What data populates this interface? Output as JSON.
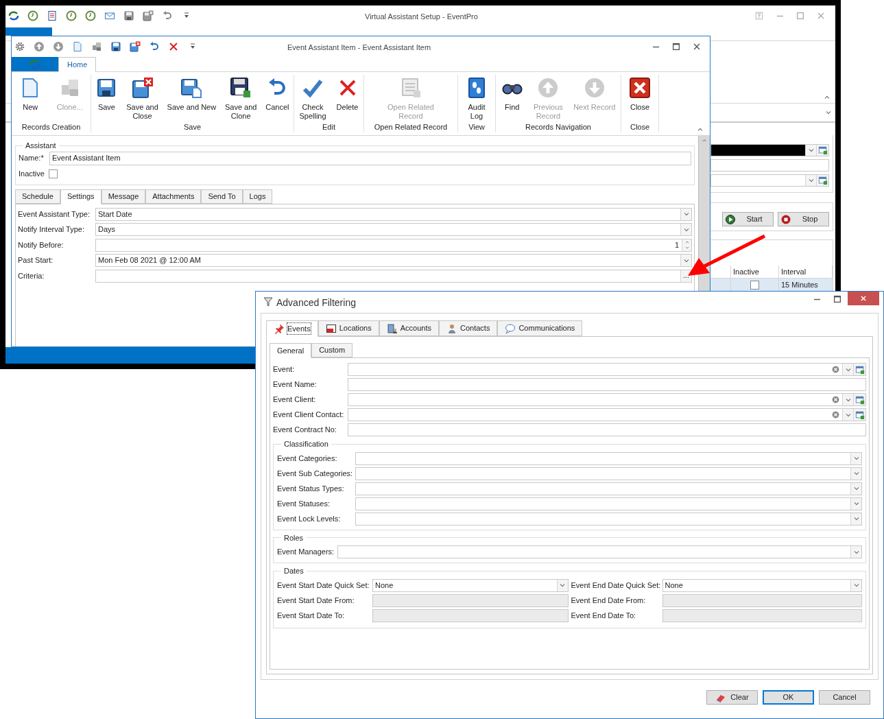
{
  "main_window": {
    "title": "Virtual Assistant Setup - EventPro",
    "control_buttons": [
      "Start",
      "Stop"
    ],
    "grid": {
      "columns": [
        "Inactive",
        "Interval"
      ],
      "rows": [
        {
          "inactive": false,
          "interval": "15 Minutes",
          "selected": true
        }
      ]
    }
  },
  "item_window": {
    "title": "Event Assistant Item - Event Assistant Item",
    "ribbon_tabs": [
      {
        "label": "Home",
        "selected": true
      }
    ],
    "ribbon_groups": [
      {
        "label": "Records Creation",
        "buttons": [
          {
            "label": "New",
            "disabled": false
          },
          {
            "label": "Clone...",
            "disabled": true
          }
        ]
      },
      {
        "label": "Save",
        "buttons": [
          {
            "label": "Save",
            "disabled": false
          },
          {
            "label": "Save and\nClose",
            "disabled": false
          },
          {
            "label": "Save and New",
            "disabled": false
          },
          {
            "label": "Save and\nClone",
            "disabled": false
          },
          {
            "label": "Cancel",
            "disabled": false
          }
        ]
      },
      {
        "label": "Edit",
        "buttons": [
          {
            "label": "Check\nSpelling",
            "disabled": false
          },
          {
            "label": "Delete",
            "disabled": false
          }
        ]
      },
      {
        "label": "Open Related Record",
        "buttons": [
          {
            "label": "Open Related\nRecord",
            "disabled": true
          }
        ]
      },
      {
        "label": "View",
        "buttons": [
          {
            "label": "Audit\nLog",
            "disabled": false
          }
        ]
      },
      {
        "label": "Records Navigation",
        "buttons": [
          {
            "label": "Find",
            "disabled": false
          },
          {
            "label": "Previous\nRecord",
            "disabled": true
          },
          {
            "label": "Next Record",
            "disabled": true
          }
        ]
      },
      {
        "label": "Close",
        "buttons": [
          {
            "label": "Close",
            "disabled": false
          }
        ]
      }
    ],
    "assistant": {
      "legend": "Assistant",
      "name_label": "Name:*",
      "name_value": "Event Assistant Item",
      "inactive_label": "Inactive",
      "inactive_checked": false
    },
    "tabs": [
      {
        "label": "Schedule",
        "selected": false
      },
      {
        "label": "Settings",
        "selected": true
      },
      {
        "label": "Message",
        "selected": false
      },
      {
        "label": "Attachments",
        "selected": false
      },
      {
        "label": "Send To",
        "selected": false
      },
      {
        "label": "Logs",
        "selected": false
      }
    ],
    "fields": [
      {
        "label": "Event Assistant Type:",
        "kind": "dropdown",
        "value": "Start Date"
      },
      {
        "label": "Notify Interval Type:",
        "kind": "dropdown",
        "value": "Days"
      },
      {
        "label": "Notify Before:",
        "kind": "spin",
        "value": "1"
      },
      {
        "label": "Past Start:",
        "kind": "dropdown",
        "value": "Mon Feb 08 2021 @ 12:00 AM"
      },
      {
        "label": "Criteria:",
        "kind": "ellipsis",
        "button": "..."
      }
    ]
  },
  "filter_dialog": {
    "title": "Advanced Filtering",
    "tabs": [
      {
        "label": "Events",
        "selected": true
      },
      {
        "label": "Locations",
        "selected": false
      },
      {
        "label": "Accounts",
        "selected": false
      },
      {
        "label": "Contacts",
        "selected": false
      },
      {
        "label": "Communications",
        "selected": false
      }
    ],
    "subtabs": [
      {
        "label": "General",
        "selected": true
      },
      {
        "label": "Custom",
        "selected": false
      }
    ],
    "fields": [
      {
        "label": "Event:",
        "kind": "lookup"
      },
      {
        "label": "Event Name:",
        "kind": "text"
      },
      {
        "label": "Event Client:",
        "kind": "lookup"
      },
      {
        "label": "Event Client Contact:",
        "kind": "lookup"
      },
      {
        "label": "Event Contract No:",
        "kind": "text"
      }
    ],
    "groups": [
      {
        "legend": "Classification",
        "fields": [
          {
            "label": "Event Categories:",
            "kind": "dropdown"
          },
          {
            "label": "Event Sub Categories:",
            "kind": "dropdown"
          },
          {
            "label": "Event Status Types:",
            "kind": "dropdown"
          },
          {
            "label": "Event Statuses:",
            "kind": "dropdown"
          },
          {
            "label": "Event Lock Levels:",
            "kind": "dropdown"
          }
        ]
      },
      {
        "legend": "Roles",
        "fields": [
          {
            "label": "Event Managers:",
            "kind": "dropdown"
          }
        ]
      }
    ],
    "dates": {
      "legend": "Dates",
      "left": [
        {
          "label": "Event Start Date Quick Set:",
          "kind": "dropdown",
          "value": "None",
          "disabled": false
        },
        {
          "label": "Event Start Date From:",
          "kind": "text",
          "disabled": true
        },
        {
          "label": "Event Start Date To:",
          "kind": "text",
          "disabled": true
        }
      ],
      "right": [
        {
          "label": "Event End Date Quick Set:",
          "kind": "dropdown",
          "value": "None",
          "disabled": false
        },
        {
          "label": "Event End Date From:",
          "kind": "text",
          "disabled": true
        },
        {
          "label": "Event End Date To:",
          "kind": "text",
          "disabled": true
        }
      ]
    },
    "buttons": [
      {
        "label": "Clear",
        "default": false
      },
      {
        "label": "OK",
        "default": true
      },
      {
        "label": "Cancel",
        "default": false
      }
    ]
  }
}
